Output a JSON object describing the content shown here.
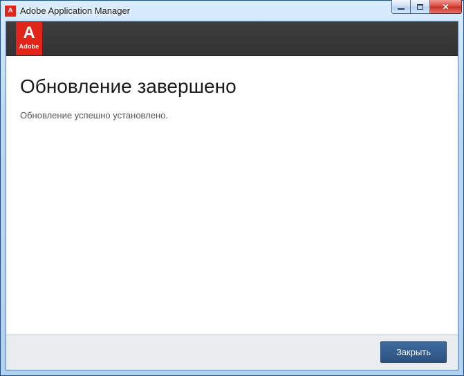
{
  "window": {
    "title": "Adobe Application Manager",
    "icon_letter": "A"
  },
  "brand": {
    "big_letter": "A",
    "word": "Adobe"
  },
  "content": {
    "heading": "Обновление завершено",
    "message": "Обновление успешно установлено."
  },
  "footer": {
    "close_label": "Закрыть"
  }
}
